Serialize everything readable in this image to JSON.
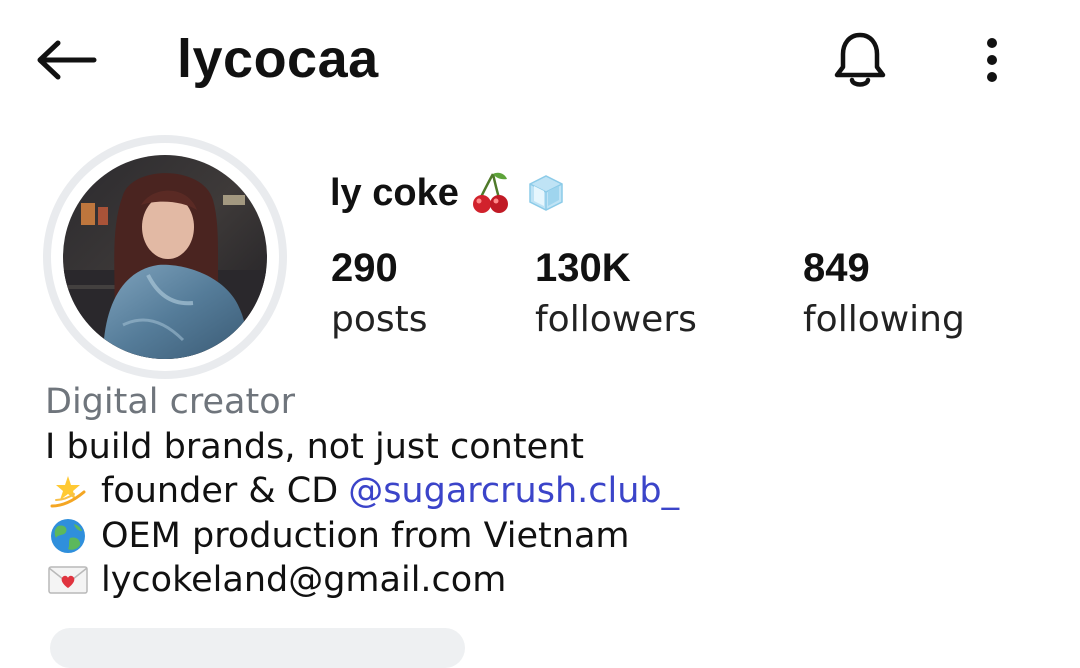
{
  "header": {
    "username": "lycocaa",
    "back_icon": "arrow-left-icon",
    "bell_icon": "bell-icon",
    "more_icon": "more-vertical-icon"
  },
  "profile": {
    "display_name": "ly coke",
    "name_emojis": [
      "cherry-emoji",
      "ice-cube-emoji"
    ]
  },
  "stats": {
    "posts": {
      "count": "290",
      "label": "posts"
    },
    "followers": {
      "count": "130K",
      "label": "followers"
    },
    "following": {
      "count": "849",
      "label": "following"
    }
  },
  "bio": {
    "category": "Digital creator",
    "line1": "I build brands, not just content",
    "line2_text": "founder & CD",
    "line2_mention": "@sugarcrush.club_",
    "line3": "OEM production from Vietnam",
    "line4": "lycokeland@gmail.com",
    "line_icons": [
      "dizzy-emoji",
      "globe-emoji",
      "love-letter-emoji"
    ]
  },
  "colors": {
    "link": "#3b44c9",
    "category": "#6f757c",
    "text": "#111111"
  }
}
